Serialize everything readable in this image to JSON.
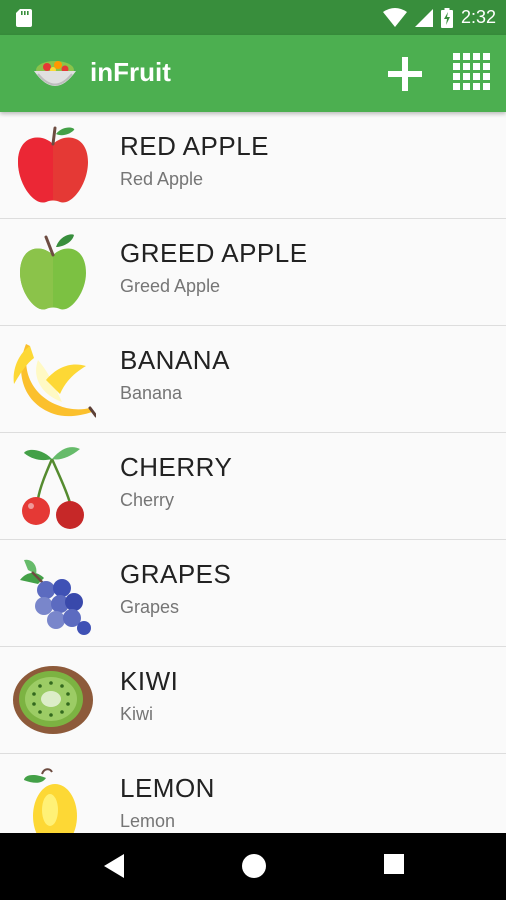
{
  "status": {
    "time": "2:32"
  },
  "appbar": {
    "title": "inFruit",
    "icons": [
      "salad-bowl-icon",
      "add-icon",
      "grid-view-icon"
    ]
  },
  "fruits": [
    {
      "name": "RED APPLE",
      "subtitle": "Red Apple",
      "icon": "red-apple-icon",
      "color": "#e53935"
    },
    {
      "name": "GREED APPLE",
      "subtitle": "Greed Apple",
      "icon": "green-apple-icon",
      "color": "#7cc142"
    },
    {
      "name": "BANANA",
      "subtitle": "Banana",
      "icon": "banana-icon",
      "color": "#fdd835"
    },
    {
      "name": "CHERRY",
      "subtitle": "Cherry",
      "icon": "cherry-icon",
      "color": "#d32f2f"
    },
    {
      "name": "GRAPES",
      "subtitle": "Grapes",
      "icon": "grapes-icon",
      "color": "#5c6bc0"
    },
    {
      "name": "KIWI",
      "subtitle": "Kiwi",
      "icon": "kiwi-icon",
      "color": "#7cb342"
    },
    {
      "name": "LEMON",
      "subtitle": "Lemon",
      "icon": "lemon-icon",
      "color": "#fdd835"
    }
  ],
  "colors": {
    "statusbar": "#388e3c",
    "appbar": "#4caf50",
    "background": "#fafafa"
  }
}
